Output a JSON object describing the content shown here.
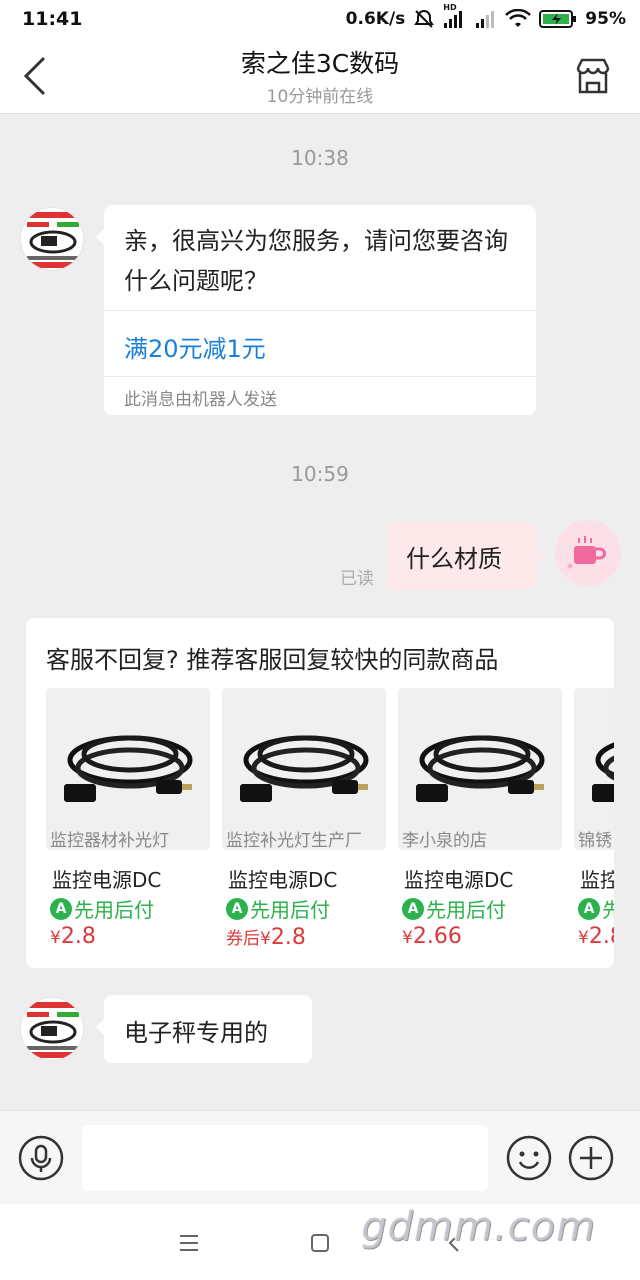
{
  "status_bar": {
    "time": "11:41",
    "net_speed": "0.6K/s",
    "network_label": "HD",
    "battery": "95%"
  },
  "header": {
    "title": "索之佳3C数码",
    "subtitle": "10分钟前在线"
  },
  "messages": {
    "time1": "10:38",
    "bot_text": "亲，很高兴为您服务，请问您要咨询什么问题呢？",
    "bot_promo": "满20元减1元",
    "bot_note": "此消息由机器人发送",
    "time2": "10:59",
    "read_label": "已读",
    "user_text": "什么材质",
    "shop_reply": "电子秤专用的"
  },
  "recommend": {
    "title": "客服不回复? 推荐客服回复较快的同款商品",
    "products": [
      {
        "shop": "监控器材补光灯",
        "name": "监控电源DC",
        "pay": "先用后付",
        "price_prefix": "",
        "currency": "¥",
        "price": "2.8"
      },
      {
        "shop": "监控补光灯生产厂",
        "name": "监控电源DC",
        "pay": "先用后付",
        "price_prefix": "券后",
        "currency": "¥",
        "price": "2.8"
      },
      {
        "shop": "李小泉的店",
        "name": "监控电源DC",
        "pay": "先用后付",
        "price_prefix": "",
        "currency": "¥",
        "price": "2.66"
      },
      {
        "shop": "锦锈",
        "name": "监控",
        "pay": "先",
        "price_prefix": "",
        "currency": "¥",
        "price": "2.8"
      }
    ]
  },
  "input": {
    "placeholder": ""
  },
  "watermark": "gdmm.com",
  "colors": {
    "accent_blue": "#1a7fd8",
    "pay_green": "#2bb24c",
    "price_red": "#d93a3a",
    "user_bubble": "#fde8ea"
  }
}
